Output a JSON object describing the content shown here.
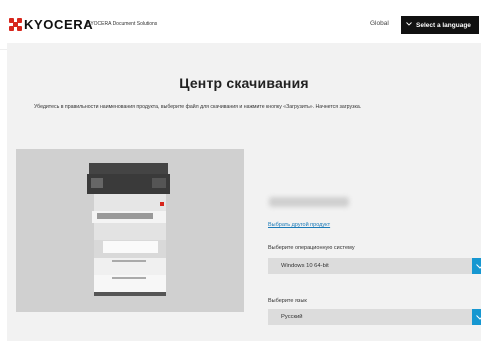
{
  "header": {
    "logo_text": "KYOCERA",
    "logo_sub": "KYOCERA Document Solutions",
    "global_label": "Global",
    "language_button": "Select a language",
    "language_chevron": "chevron-down-icon"
  },
  "main": {
    "title": "Центр скачивания",
    "intro": "Убедитесь в правильности наименования продукта, выберите файл для скачивания и нажмите кнопку «Загрузить». Начнется загрузка.",
    "other_product_link": "Выбрать другой продукт",
    "os_label": "Выберите операционную систему",
    "os_value": "Windows 10 64-bit",
    "lang_label": "Выберите язык",
    "lang_value": "Русский"
  },
  "colors": {
    "accent": "#1697d1",
    "brand_red": "#d7261c",
    "link": "#1a7ab8"
  }
}
